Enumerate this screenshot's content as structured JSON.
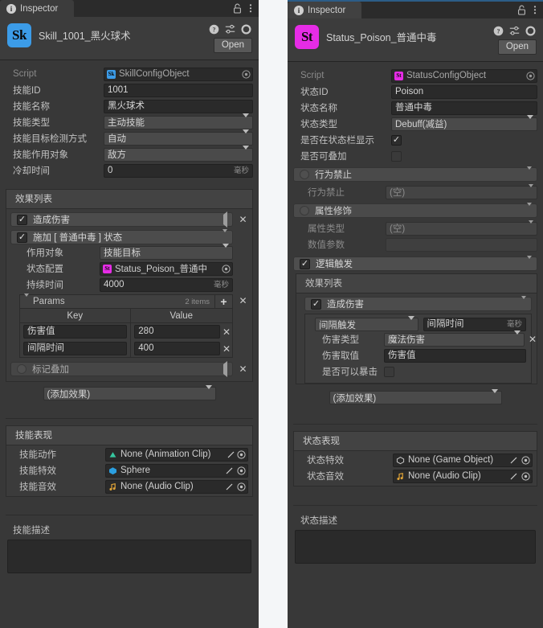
{
  "left_panel": {
    "tab": {
      "label": "Inspector",
      "icon": "info-icon"
    },
    "tools": {
      "lock": "lock-icon",
      "menu": "kebab-menu-icon"
    },
    "header": {
      "icon_text": "Sk",
      "icon_color": "#3c9ce8",
      "title": "Skill_1001_黑火球术",
      "help": "help-icon",
      "preset": "preset-icon",
      "settings": "gear-icon",
      "open_label": "Open"
    },
    "fields": {
      "script_label": "Script",
      "script_value": "SkillConfigObject",
      "script_chip": "Sk",
      "skill_id_label": "技能ID",
      "skill_id_value": "1001",
      "skill_name_label": "技能名称",
      "skill_name_value": "黑火球术",
      "skill_type_label": "技能类型",
      "skill_type_value": "主动技能",
      "detect_label": "技能目标检测方式",
      "detect_value": "自动",
      "target_label": "技能作用对象",
      "target_value": "敌方",
      "cooldown_label": "冷却时间",
      "cooldown_value": "0",
      "cooldown_suffix": "毫秒"
    },
    "effect_list": {
      "title": "效果列表",
      "items": [
        {
          "label": "造成伤害",
          "checked": true,
          "expanded": false
        },
        {
          "label": "施加 [ 普通中毒 ] 状态",
          "checked": true,
          "expanded": true
        },
        {
          "label": "标记叠加",
          "checked": false,
          "expanded": false
        }
      ],
      "status_effect": {
        "target_label": "作用对象",
        "target_value": "技能目标",
        "config_label": "状态配置",
        "config_value": "Status_Poison_普通中",
        "config_chip": "St",
        "duration_label": "持续时间",
        "duration_value": "4000",
        "duration_suffix": "毫秒",
        "params_label": "Params",
        "params_count": "2 items",
        "params_add": "+",
        "col_key": "Key",
        "col_value": "Value",
        "rows": [
          {
            "key": "伤害值",
            "value": "280"
          },
          {
            "key": "间隔时间",
            "value": "400"
          }
        ]
      },
      "add_effect": "(添加效果)"
    },
    "presentation": {
      "title": "技能表现",
      "rows": [
        {
          "label": "技能动作",
          "value": "None (Animation Clip)",
          "icon": "animation-clip-icon"
        },
        {
          "label": "技能特效",
          "value": "Sphere",
          "icon": "prefab-icon"
        },
        {
          "label": "技能音效",
          "value": "None (Audio Clip)",
          "icon": "audio-clip-icon"
        }
      ]
    },
    "description": {
      "label": "技能描述",
      "value": ""
    }
  },
  "right_panel": {
    "tab": {
      "label": "Inspector",
      "icon": "info-icon"
    },
    "tools": {
      "lock": "lock-icon",
      "menu": "kebab-menu-icon"
    },
    "header": {
      "icon_text": "St",
      "icon_color": "#e62ce6",
      "title": "Status_Poison_普通中毒",
      "help": "help-icon",
      "preset": "preset-icon",
      "settings": "gear-icon",
      "open_label": "Open"
    },
    "fields": {
      "script_label": "Script",
      "script_value": "StatusConfigObject",
      "script_chip": "St",
      "status_id_label": "状态ID",
      "status_id_value": "Poison",
      "status_name_label": "状态名称",
      "status_name_value": "普通中毒",
      "status_type_label": "状态类型",
      "status_type_value": "Debuff(减益)",
      "show_in_bar_label": "是否在状态栏显示",
      "show_in_bar_checked": true,
      "stackable_label": "是否可叠加",
      "stackable_checked": false
    },
    "modules": [
      {
        "name": "行为禁止",
        "checked": false,
        "rows": [
          {
            "label": "行为禁止",
            "value": "(空)",
            "type": "popup",
            "dim": true
          }
        ]
      },
      {
        "name": "属性修饰",
        "checked": false,
        "rows": [
          {
            "label": "属性类型",
            "value": "(空)",
            "type": "popup",
            "dim": true
          },
          {
            "label": "数值参数",
            "value": "",
            "type": "text",
            "dim": true
          }
        ]
      }
    ],
    "logic_trigger": {
      "name": "逻辑触发",
      "checked": true,
      "effect_list_title": "效果列表",
      "effect": {
        "label": "造成伤害",
        "checked": true,
        "trigger_mode": "间隔触发",
        "interval_placeholder": "间隔时间",
        "interval_suffix": "毫秒",
        "damage_type_label": "伤害类型",
        "damage_type_value": "魔法伤害",
        "damage_value_label": "伤害取值",
        "damage_value_value": "伤害值",
        "crit_label": "是否可以暴击",
        "crit_checked": false
      },
      "add_effect": "(添加效果)"
    },
    "presentation": {
      "title": "状态表现",
      "rows": [
        {
          "label": "状态特效",
          "value": "None (Game Object)",
          "icon": "game-object-icon"
        },
        {
          "label": "状态音效",
          "value": "None (Audio Clip)",
          "icon": "audio-clip-icon"
        }
      ]
    },
    "description": {
      "label": "状态描述",
      "value": ""
    }
  }
}
